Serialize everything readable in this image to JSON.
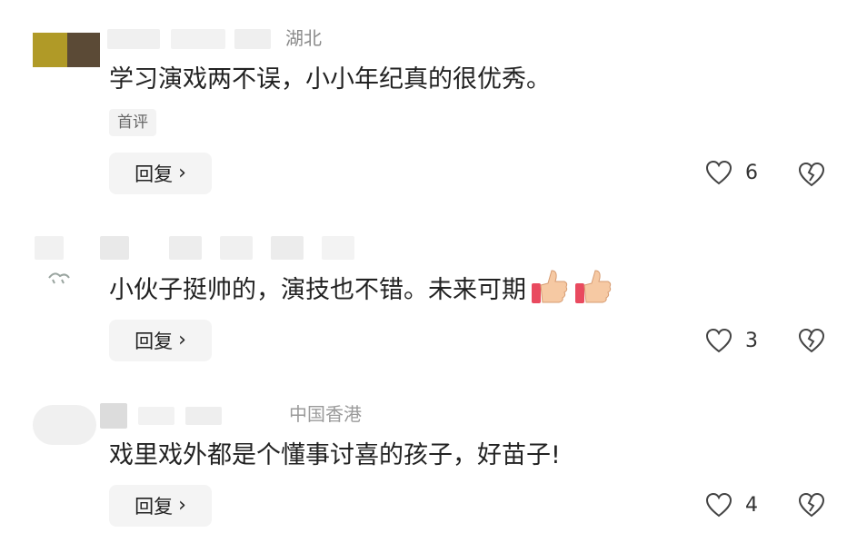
{
  "comments": [
    {
      "location": "湖北",
      "text": "学习演戏两不误，小小年纪真的很优秀。",
      "tag": "首评",
      "reply_label": "回复",
      "chevron": "›",
      "likes": "6",
      "like_icon": "heart-outline-icon",
      "dislike_icon": "broken-heart-icon",
      "avatar_colors": [
        "#b09a27",
        "#5b4a36"
      ]
    },
    {
      "location": "",
      "text": "小伙子挺帅的，演技也不错。未来可期",
      "emoji": [
        "thumbs-up-icon",
        "thumbs-up-icon"
      ],
      "reply_label": "回复",
      "chevron": "›",
      "likes": "3",
      "like_icon": "heart-outline-icon",
      "dislike_icon": "broken-heart-icon"
    },
    {
      "location": "中国香港",
      "text": "戏里戏外都是个懂事讨喜的孩子，好苗子!",
      "reply_label": "回复",
      "chevron": "›",
      "likes": "4",
      "like_icon": "heart-outline-icon",
      "dislike_icon": "broken-heart-icon"
    }
  ]
}
